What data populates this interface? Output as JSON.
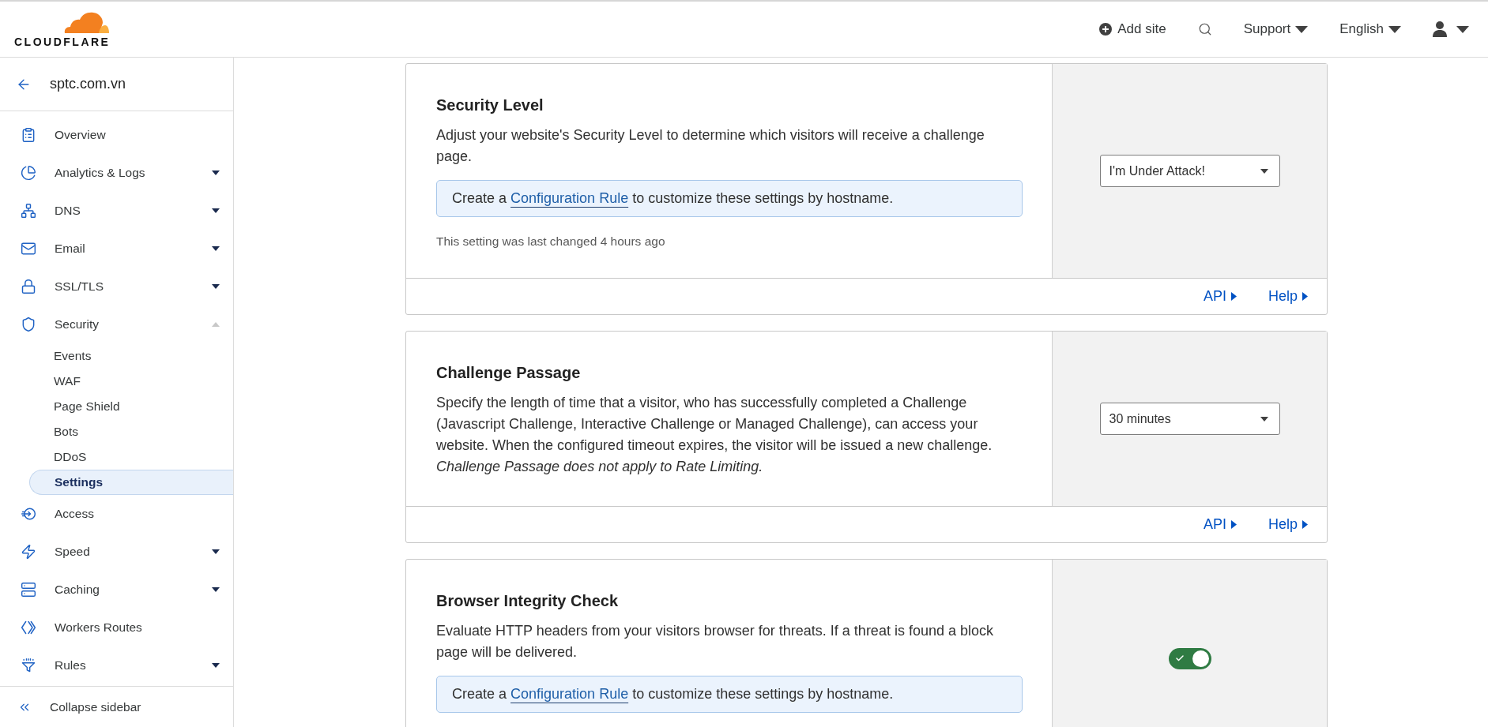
{
  "header": {
    "logo": "CLOUDFLARE",
    "actions": [
      {
        "kind": "add",
        "label": "Add site"
      },
      {
        "kind": "search"
      },
      {
        "kind": "menu",
        "label": "Support"
      },
      {
        "kind": "menu",
        "label": "English"
      },
      {
        "kind": "account"
      }
    ]
  },
  "sidebar": {
    "site": "sptc.com.vn",
    "items": [
      {
        "label": "Overview",
        "selected": false
      },
      {
        "label": "Analytics & Logs",
        "selected": false,
        "expanded": false
      },
      {
        "label": "DNS",
        "selected": false,
        "expanded": false
      },
      {
        "label": "Email",
        "selected": false,
        "expanded": false
      },
      {
        "label": "SSL/TLS",
        "selected": false,
        "expanded": false
      },
      {
        "label": "Security",
        "selected": false,
        "expanded": true,
        "children": [
          {
            "label": "Events",
            "selected": false
          },
          {
            "label": "WAF",
            "selected": false
          },
          {
            "label": "Page Shield",
            "selected": false
          },
          {
            "label": "Bots",
            "selected": false
          },
          {
            "label": "DDoS",
            "selected": false
          },
          {
            "label": "Settings",
            "selected": true
          }
        ]
      },
      {
        "label": "Access",
        "selected": false
      },
      {
        "label": "Speed",
        "selected": false,
        "expanded": false
      },
      {
        "label": "Caching",
        "selected": false,
        "expanded": false
      },
      {
        "label": "Workers Routes",
        "selected": false
      },
      {
        "label": "Rules",
        "selected": false,
        "expanded": false
      }
    ],
    "collapse": "Collapse sidebar"
  },
  "cards": [
    {
      "title": "Security Level",
      "description": "Adjust your website's Security Level to determine which visitors will receive a challenge page.",
      "info": {
        "before": "Create a",
        "link": "Configuration Rule",
        "after": "to customize these settings by hostname."
      },
      "last_changed": "This setting was last changed 4 hours ago",
      "control": {
        "kind": "select",
        "value": "I'm Under Attack!"
      },
      "links": [
        "API",
        "Help"
      ]
    },
    {
      "title": "Challenge Passage",
      "description": "Specify the length of time that a visitor, who has successfully completed a Challenge (Javascript Challenge, Interactive Challenge or Managed Challenge), can access your website. When the configured timeout expires, the visitor will be issued a new challenge.",
      "note": "Challenge Passage does not apply to Rate Limiting.",
      "control": {
        "kind": "select",
        "value": "30 minutes"
      },
      "links": [
        "API",
        "Help"
      ]
    },
    {
      "title": "Browser Integrity Check",
      "description": "Evaluate HTTP headers from your visitors browser for threats. If a threat is found a block page will be delivered.",
      "info": {
        "before": "Create a",
        "link": "Configuration Rule",
        "after": "to customize these settings by hostname."
      },
      "control": {
        "kind": "toggle",
        "on": true
      }
    }
  ]
}
